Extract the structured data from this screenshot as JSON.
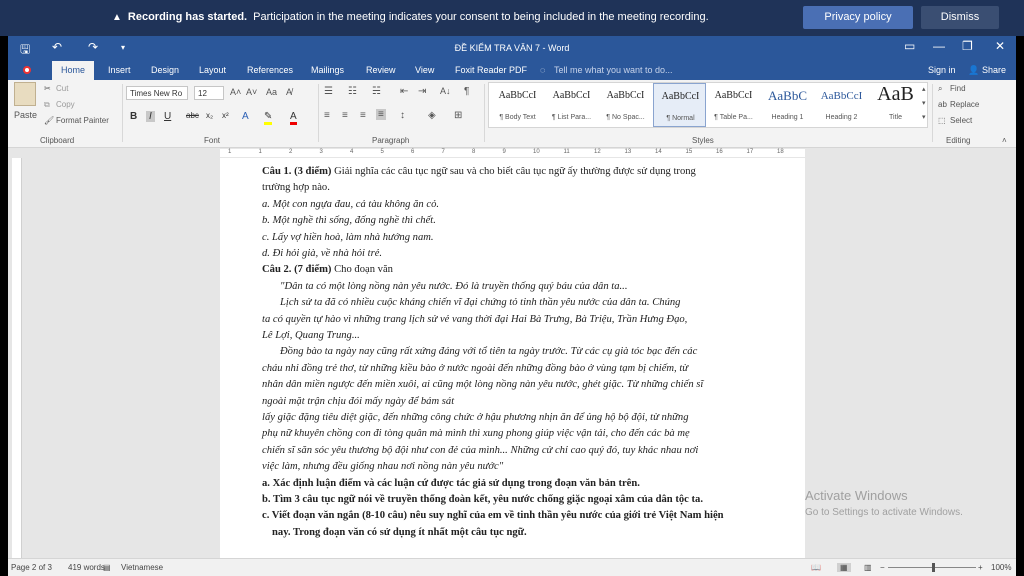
{
  "recording": {
    "title": "Recording has started.",
    "message": "Participation in the meeting indicates your consent to being included in the meeting recording.",
    "privacy_label": "Privacy policy",
    "dismiss_label": "Dismiss",
    "icon": "warning-icon"
  },
  "window": {
    "title": "ĐỀ KIỂM TRA VĂN 7 - Word"
  },
  "tabs": {
    "home": "Home",
    "insert": "Insert",
    "design": "Design",
    "layout": "Layout",
    "references": "References",
    "mailings": "Mailings",
    "review": "Review",
    "view": "View",
    "foxit": "Foxit Reader PDF",
    "tell_me": "Tell me what you want to do...",
    "sign_in": "Sign in",
    "share": "Share"
  },
  "ribbon": {
    "paste": "Paste",
    "cut": "Cut",
    "copy": "Copy",
    "format_painter": "Format Painter",
    "clipboard": "Clipboard",
    "font_name": "Times New Ro",
    "font_size": "12",
    "font": "Font",
    "paragraph": "Paragraph",
    "styles_label": "Styles",
    "editing": "Editing",
    "find": "Find",
    "replace": "Replace",
    "select": "Select",
    "styles": [
      {
        "preview": "AaBbCcI",
        "name": "¶ Body Text"
      },
      {
        "preview": "AaBbCcI",
        "name": "¶ List Para..."
      },
      {
        "preview": "AaBbCcI",
        "name": "¶ No Spac..."
      },
      {
        "preview": "AaBbCcI",
        "name": "¶ Normal"
      },
      {
        "preview": "AaBbCcI",
        "name": "¶ Table Pa..."
      },
      {
        "preview": "AaBbC",
        "name": "Heading 1"
      },
      {
        "preview": "AaBbCcI",
        "name": "Heading 2"
      },
      {
        "preview": "AaB",
        "name": "Title"
      }
    ]
  },
  "ruler": {
    "ticks": [
      "1",
      "1",
      "2",
      "3",
      "4",
      "5",
      "6",
      "7",
      "8",
      "9",
      "10",
      "11",
      "12",
      "13",
      "14",
      "15",
      "16",
      "17",
      "18"
    ]
  },
  "document": {
    "lines": [
      {
        "style": "",
        "bold_part": "Câu 1. (3 điểm)",
        "text": " Giải nghĩa các câu tục ngữ sau và cho biết câu tục ngữ ấy thường được sử dụng trong"
      },
      {
        "style": "",
        "bold_part": "",
        "text": "trường hợp nào."
      },
      {
        "style": "i",
        "bold_part": "",
        "text": "a. Một con ngựa đau, cả tàu không ăn cỏ."
      },
      {
        "style": "i",
        "bold_part": "",
        "text": "b. Một nghề thì sống, đống nghề thì chết."
      },
      {
        "style": "i",
        "bold_part": "",
        "text": "c. Lấy vợ hiền hoà, làm nhà hướng nam."
      },
      {
        "style": "i",
        "bold_part": "",
        "text": "d. Đi hỏi già, về nhà hỏi trẻ."
      },
      {
        "style": "",
        "bold_part": "Câu 2. (7 điểm)",
        "text": " Cho đoạn văn"
      },
      {
        "style": "i ind",
        "bold_part": "",
        "text": "\"Dân ta có một lòng nồng nàn yêu nước. Đó là truyền thống quý báu của dân ta..."
      },
      {
        "style": "i ind",
        "bold_part": "",
        "text": "Lịch sử ta đã có nhiều cuộc kháng chiến vĩ đại chứng tỏ tinh thần yêu nước của dân ta. Chúng"
      },
      {
        "style": "i",
        "bold_part": "",
        "text": "ta có quyền tự hào vì những trang lịch sử vẻ vang thời đại Hai Bà Trưng, Bà Triệu, Trần Hưng Đạo,"
      },
      {
        "style": "i",
        "bold_part": "",
        "text": "Lê Lợi, Quang Trung..."
      },
      {
        "style": "i ind",
        "bold_part": "",
        "text": "Đồng bào ta ngày nay cũng rất xứng đáng với tổ tiên ta ngày trước. Từ các cụ già tóc bạc đến các"
      },
      {
        "style": "i",
        "bold_part": "",
        "text": "cháu nhi đồng trẻ thơ, từ những kiều bào ở nước ngoài đến những đồng bào ở vùng tạm bị chiếm, từ"
      },
      {
        "style": "i",
        "bold_part": "",
        "text": "nhân dân miền ngược đến miền xuôi, ai cũng một lòng nồng nàn yêu nước, ghét giặc. Từ những chiến sĩ"
      },
      {
        "style": "i",
        "bold_part": "",
        "text": "ngoài mặt trận chịu đói mấy ngày để bám sát"
      },
      {
        "style": "i",
        "bold_part": "",
        "text": "lấy giặc đặng tiêu diệt giặc, đến những công chức ở hậu phương nhịn ăn để ủng hộ bộ đội, từ những"
      },
      {
        "style": "i",
        "bold_part": "",
        "text": "phụ nữ khuyên chồng con đi tòng quân mà mình thì xung phong giúp việc vận tải, cho đến các bà mẹ"
      },
      {
        "style": "i",
        "bold_part": "",
        "text": "chiến sĩ săn sóc yêu thương bộ đội như con đẻ của mình... Những cử chỉ cao quý đó, tuy khác nhau nơi"
      },
      {
        "style": "i",
        "bold_part": "",
        "text": "việc làm, nhưng đều giống nhau nơi nồng nàn yêu nước\""
      },
      {
        "style": "b",
        "bold_part": "",
        "text": "a. Xác định luận điểm và các luận cứ được tác giả sử dụng trong đoạn văn bản trên."
      },
      {
        "style": "b",
        "bold_part": "",
        "text": "b. Tìm 3 câu tục ngữ nói về truyền thống đoàn kết, yêu nước chống giặc ngoại xâm của dân tộc ta."
      },
      {
        "style": "b",
        "bold_part": "",
        "text": "c. Viết đoạn văn ngắn (8-10 câu) nêu suy nghĩ của em về tinh thần yêu nước của giới trẻ Việt Nam hiện"
      },
      {
        "style": "b hang",
        "bold_part": "",
        "text": "nay. Trong đoạn văn có sử dụng ít nhất một câu tục ngữ."
      }
    ]
  },
  "watermark": {
    "title": "Activate Windows",
    "subtitle": "Go to Settings to activate Windows."
  },
  "status": {
    "page": "Page 2 of 3",
    "words": "419 words",
    "language": "Vietnamese",
    "zoom": "100%"
  }
}
